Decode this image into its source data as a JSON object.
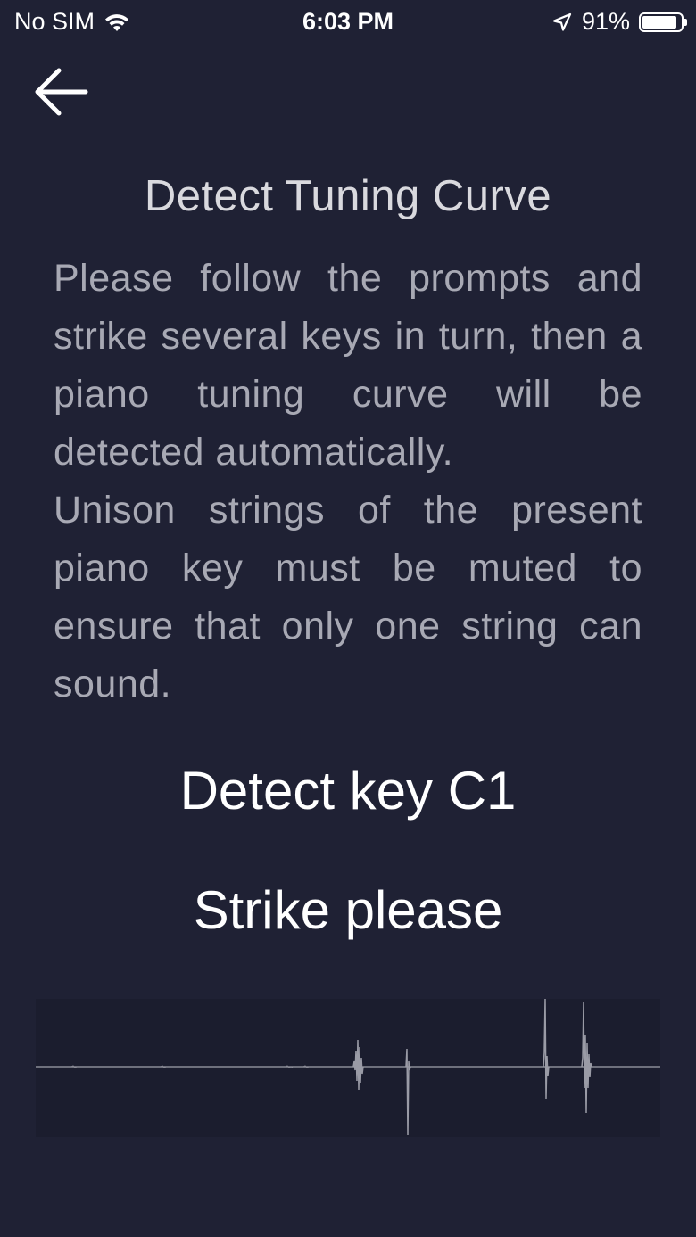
{
  "status_bar": {
    "carrier": "No SIM",
    "time": "6:03 PM",
    "battery_percent": "91%",
    "battery_level": 0.91,
    "icons": [
      "wifi-icon",
      "location-arrow-icon",
      "battery-icon"
    ]
  },
  "nav": {
    "back_icon": "arrow-left-icon"
  },
  "page": {
    "title": "Detect Tuning Curve",
    "instructions": [
      "Please follow the prompts and strike several keys in turn, then a piano tuning curve will be detected automatically.",
      "Unison strings of the present piano key must be muted to ensure that only one string can sound."
    ],
    "detect_key_label": "Detect key C1",
    "strike_prompt": "Strike please"
  },
  "colors": {
    "background": "#1f2134",
    "waveform_background": "#1b1d2e",
    "waveform_line": "#8a8b96",
    "title_text": "#d9d9de",
    "body_text": "#a8a9b4"
  }
}
